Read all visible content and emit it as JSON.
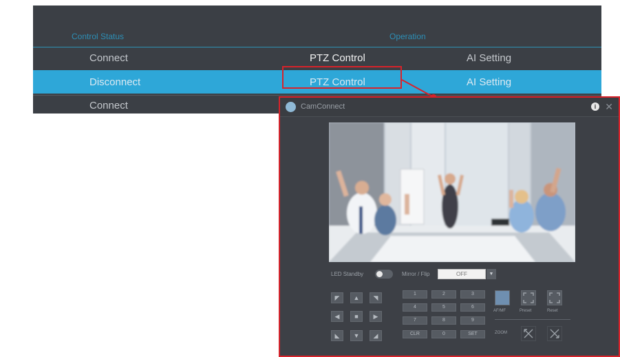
{
  "table": {
    "headers": {
      "status": "Control Status",
      "operation": "Operation"
    },
    "rows": [
      {
        "status": "Connect",
        "ptz": "PTZ Control",
        "ai": "AI Setting",
        "selected": false
      },
      {
        "status": "Disconnect",
        "ptz": "PTZ Control",
        "ai": "AI Setting",
        "selected": true
      },
      {
        "status": "Connect",
        "ptz": "",
        "ai": "",
        "selected": false
      }
    ]
  },
  "dialog": {
    "title": "CamConnect",
    "info_glyph": "i",
    "close_glyph": "✕",
    "controls": {
      "tracking_label": "LED Standby",
      "mirror_label": "Mirror / Flip",
      "mirror_value": "OFF",
      "dropdown_glyph": "▼"
    },
    "pad": {
      "arrows": [
        "◤",
        "▲",
        "◥",
        "◀",
        "■",
        "▶",
        "◣",
        "▼",
        "◢"
      ],
      "numbers": [
        "1",
        "2",
        "3",
        "4",
        "5",
        "6",
        "7",
        "8",
        "9",
        "CLR",
        "0",
        "SET"
      ]
    },
    "modes": {
      "a": "AF/MF",
      "b": "Preset",
      "c": "Reset",
      "zoom": "ZOOM"
    }
  },
  "colors": {
    "highlight": "#2ea7d8",
    "callout": "#d9222a",
    "panel": "#3d4046"
  }
}
